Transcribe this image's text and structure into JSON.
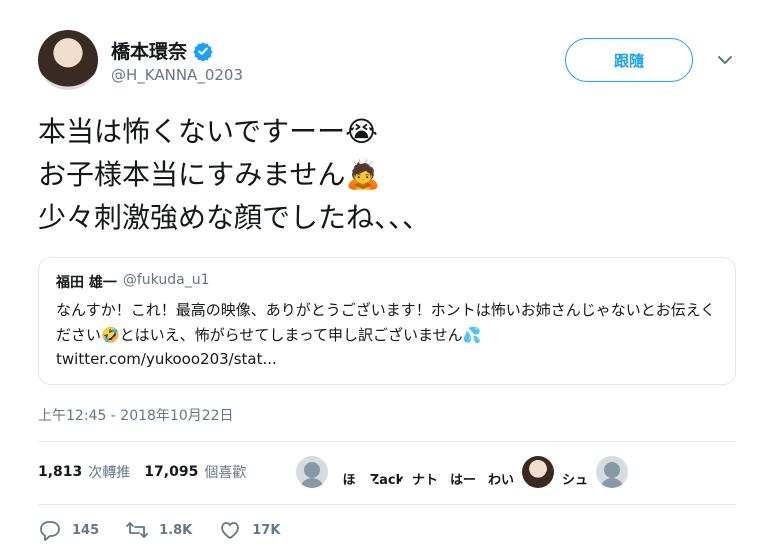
{
  "user": {
    "name": "橋本環奈",
    "handle": "@H_KANNA_0203",
    "follow_label": "跟隨"
  },
  "tweet": {
    "text": "本当は怖くないですーー😭\nお子様本当にすみません🙇\n少々刺激強めな顔でしたね、、、"
  },
  "quote": {
    "name": "福田 雄一",
    "handle": "@fukuda_u1",
    "text": "なんすか！これ！最高の映像、ありがとうございます！ホントは怖いお姉さんじゃないとお伝えください🤣とはいえ、怖がらせてしまって申し訳ございません💦",
    "link": "twitter.com/yukooo203/stat..."
  },
  "timestamp": "上午12:45 - 2018年10月22日",
  "stats": {
    "retweets_count": "1,813",
    "retweets_label": "次轉推",
    "likes_count": "17,095",
    "likes_label": "個喜歡"
  },
  "likers": [
    "",
    "ほ",
    "Zack",
    "ナト",
    "はー",
    "わい",
    "",
    "シュ",
    ""
  ],
  "actions": {
    "replies": "145",
    "retweets": "1.8K",
    "likes": "17K"
  },
  "colors": {
    "accent": "#1da1f2",
    "muted": "#657786",
    "border": "#e1e8ed"
  }
}
